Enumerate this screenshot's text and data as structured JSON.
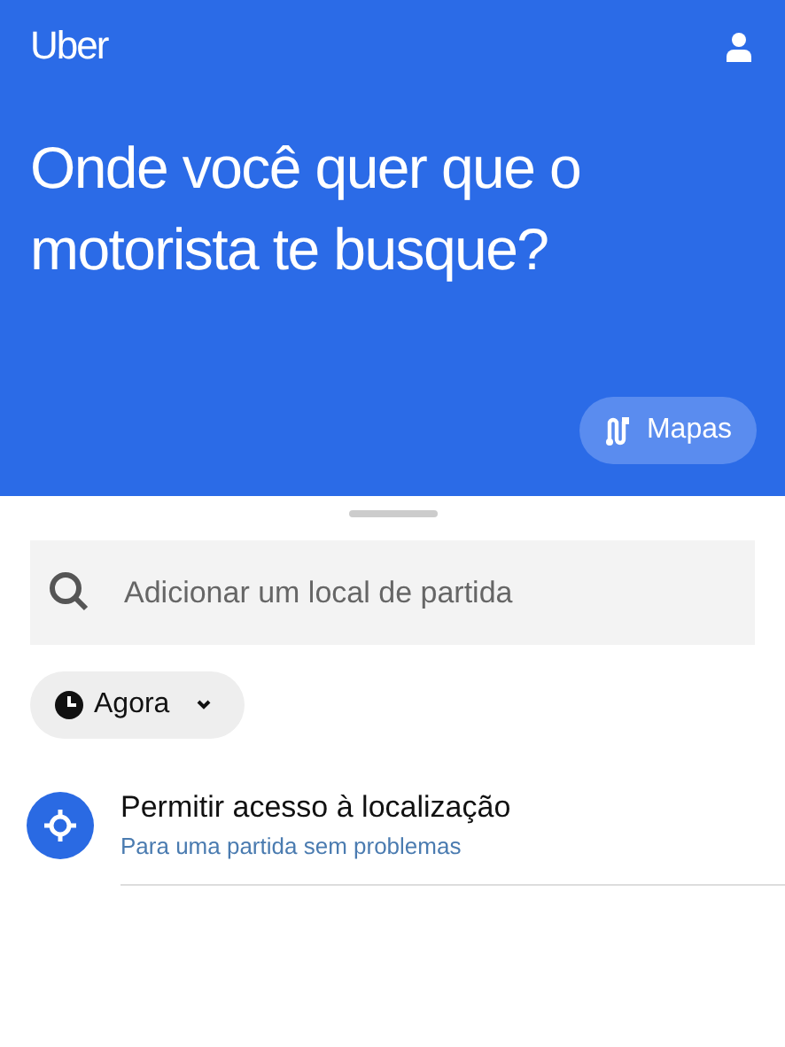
{
  "header": {
    "logo": "Uber",
    "heading": "Onde você quer que o motorista te busque?",
    "map_button": "Mapas"
  },
  "search": {
    "placeholder": "Adicionar um local de partida"
  },
  "time_button": "Agora",
  "suggestions": [
    {
      "title": "Permitir acesso à localização",
      "subtitle": "Para uma partida sem problemas"
    }
  ]
}
